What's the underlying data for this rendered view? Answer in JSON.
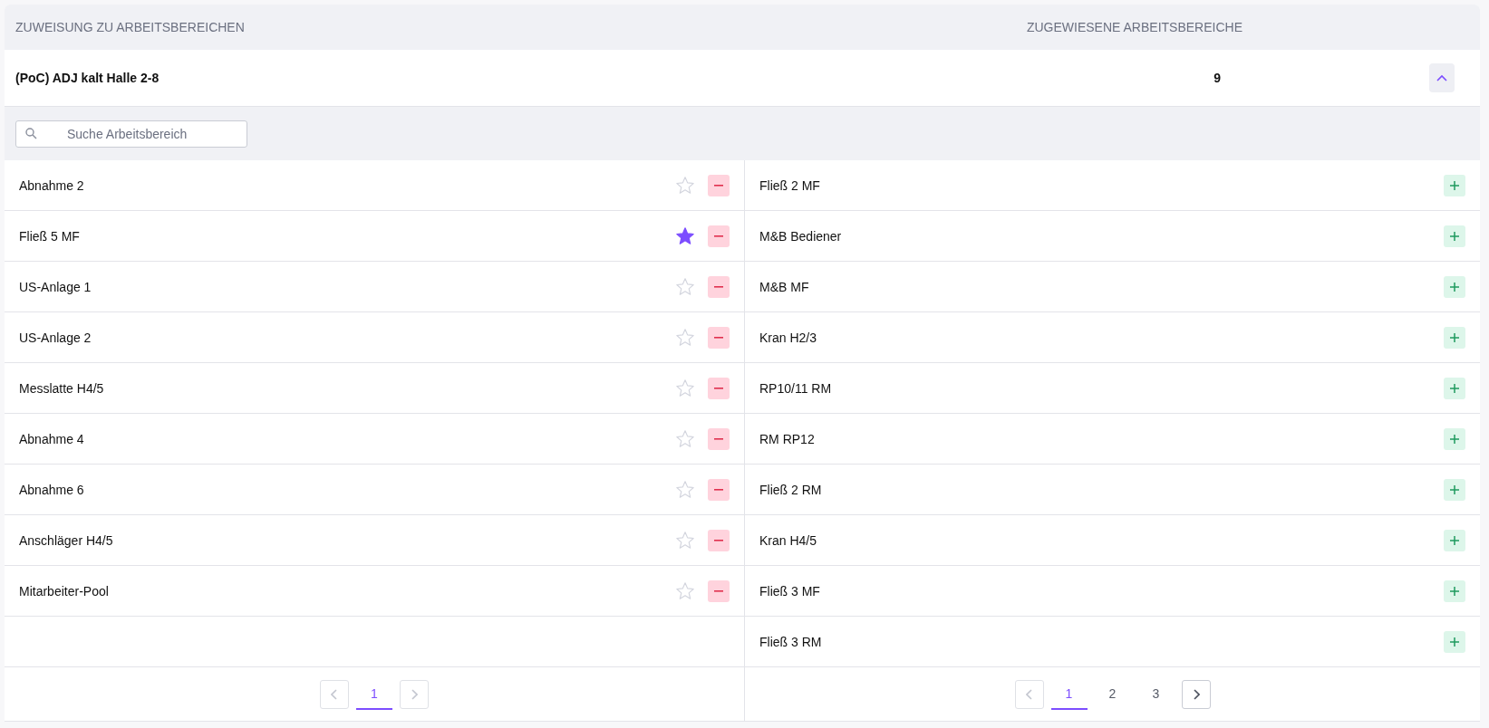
{
  "header": {
    "column_1": "ZUWEISUNG ZU ARBEITSBEREICHEN",
    "column_2": "ZUGEWIESENE ARBEITSBEREICHE"
  },
  "group": {
    "name": "(PoC) ADJ kalt Halle 2-8",
    "count": "9",
    "expanded": true
  },
  "search": {
    "placeholder": "Suche Arbeitsbereich"
  },
  "assigned": {
    "items": [
      {
        "name": "Abnahme 2",
        "favorite": false
      },
      {
        "name": "Fließ 5 MF",
        "favorite": true
      },
      {
        "name": "US-Anlage 1",
        "favorite": false
      },
      {
        "name": "US-Anlage 2",
        "favorite": false
      },
      {
        "name": "Messlatte H4/5",
        "favorite": false
      },
      {
        "name": "Abnahme 4",
        "favorite": false
      },
      {
        "name": "Abnahme 6",
        "favorite": false
      },
      {
        "name": "Anschläger H4/5",
        "favorite": false
      },
      {
        "name": "Mitarbeiter-Pool",
        "favorite": false
      }
    ],
    "pagination": {
      "prev_disabled": true,
      "next_disabled": true,
      "pages": [
        {
          "label": "1",
          "selected": true
        }
      ]
    }
  },
  "available": {
    "items": [
      {
        "name": "Fließ 2 MF"
      },
      {
        "name": "M&B Bediener"
      },
      {
        "name": "M&B MF"
      },
      {
        "name": "Kran H2/3"
      },
      {
        "name": "RP10/11 RM"
      },
      {
        "name": "RM RP12"
      },
      {
        "name": "Fließ 2 RM"
      },
      {
        "name": "Kran H4/5"
      },
      {
        "name": "Fließ 3 MF"
      },
      {
        "name": "Fließ 3 RM"
      }
    ],
    "pagination": {
      "prev_disabled": true,
      "next_disabled": false,
      "pages": [
        {
          "label": "1",
          "selected": true
        },
        {
          "label": "2",
          "selected": false
        },
        {
          "label": "3",
          "selected": false
        }
      ]
    }
  }
}
